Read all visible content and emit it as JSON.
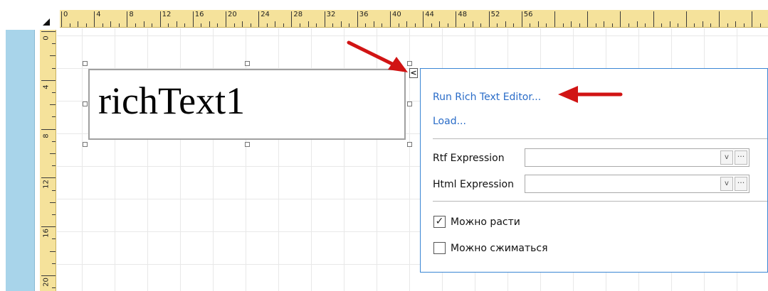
{
  "ruler": {
    "h_labels": [
      "0",
      "4",
      "8",
      "12",
      "16",
      "20",
      "24",
      "28",
      "32",
      "36",
      "40",
      "44",
      "48",
      "52",
      "56"
    ],
    "v_labels": [
      "0",
      "4",
      "8",
      "12",
      "16",
      "20"
    ]
  },
  "control": {
    "text": "richText1"
  },
  "smart_tag": {
    "glyph": "<"
  },
  "panel": {
    "run_editor_link": "Run Rich Text Editor...",
    "load_link": "Load...",
    "rtf_label": "Rtf Expression",
    "html_label": "Html Expression",
    "dropdown_glyph": "v",
    "ellipsis_glyph": "···",
    "can_grow_label": "Можно расти",
    "can_grow_checked": true,
    "can_shrink_label": "Можно сжиматься",
    "can_shrink_checked": false
  },
  "colors": {
    "ruler": "#f5e29b",
    "left_bar": "#a8d4ea",
    "panel_border": "#3a86d4",
    "link": "#2a6cc8",
    "arrow": "#d11414"
  }
}
